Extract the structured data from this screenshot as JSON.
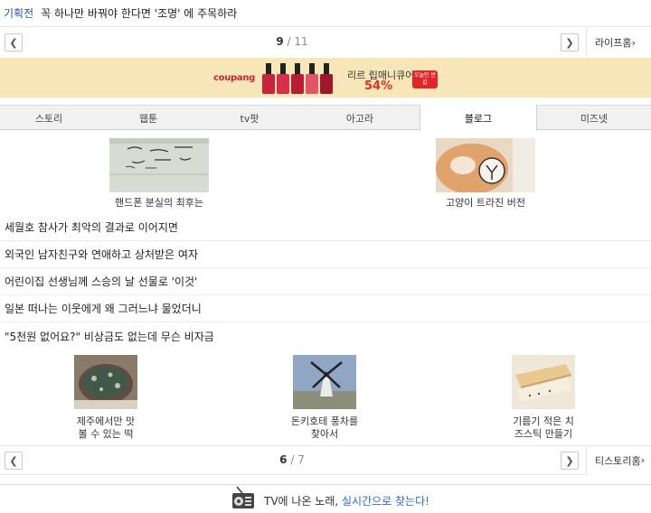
{
  "top_article": {
    "category": "기획전",
    "title": "꼭 하나만 바꿔야 한다면 '조명' 에 주목하라"
  },
  "pager_top": {
    "current": "9",
    "separator": " / ",
    "total": "11",
    "more_label": "라이프홈"
  },
  "ad": {
    "brand": "coupang",
    "product": "리르 립매니큐어",
    "discount": "54%",
    "badge": "오늘만 반값",
    "accent": "#e5331b",
    "background": "#f6e6b8"
  },
  "tabs": [
    {
      "label": "스토리"
    },
    {
      "label": "웹툰"
    },
    {
      "label": "tv팟"
    },
    {
      "label": "아고라"
    },
    {
      "label": "블로그",
      "active": true
    },
    {
      "label": "미즈넷"
    }
  ],
  "thumbs_top": [
    {
      "caption": "핸드폰 분실의 최후는",
      "icon": "paper-note-image"
    },
    {
      "caption": "고양이 트라진 버전",
      "icon": "cat-image"
    }
  ],
  "articles": [
    "세월호 참사가 최악의 결과로 이어지면",
    "외국인 남자친구와 연애하고 상처받은 여자",
    "어린이집 선생님께 스승의 날 선물로 '이것'",
    "일본 떠나는 이웃에게 왜 그러느냐 물었더니",
    "\"5천원 없어요?\" 비상금도 없는데 무슨 비자금"
  ],
  "thumbs_bottom": [
    {
      "caption_line1": "제주에서만 맛",
      "caption_line2": "볼 수 있는 떡",
      "icon": "rice-cake-image"
    },
    {
      "caption_line1": "돈키호테 풍차를",
      "caption_line2": "찾아서",
      "icon": "windmill-image"
    },
    {
      "caption_line1": "기름기 적은 치",
      "caption_line2": "즈스틱 만들기",
      "icon": "cheese-stick-image"
    }
  ],
  "pager_bottom": {
    "current": "6",
    "separator": " / ",
    "total": "7",
    "more_label": "티스토리홈"
  },
  "bottom_banner": {
    "prefix": "TV에 나온 노래, ",
    "highlight": "실시간으로 찾는다!",
    "icon": "radio-icon"
  }
}
